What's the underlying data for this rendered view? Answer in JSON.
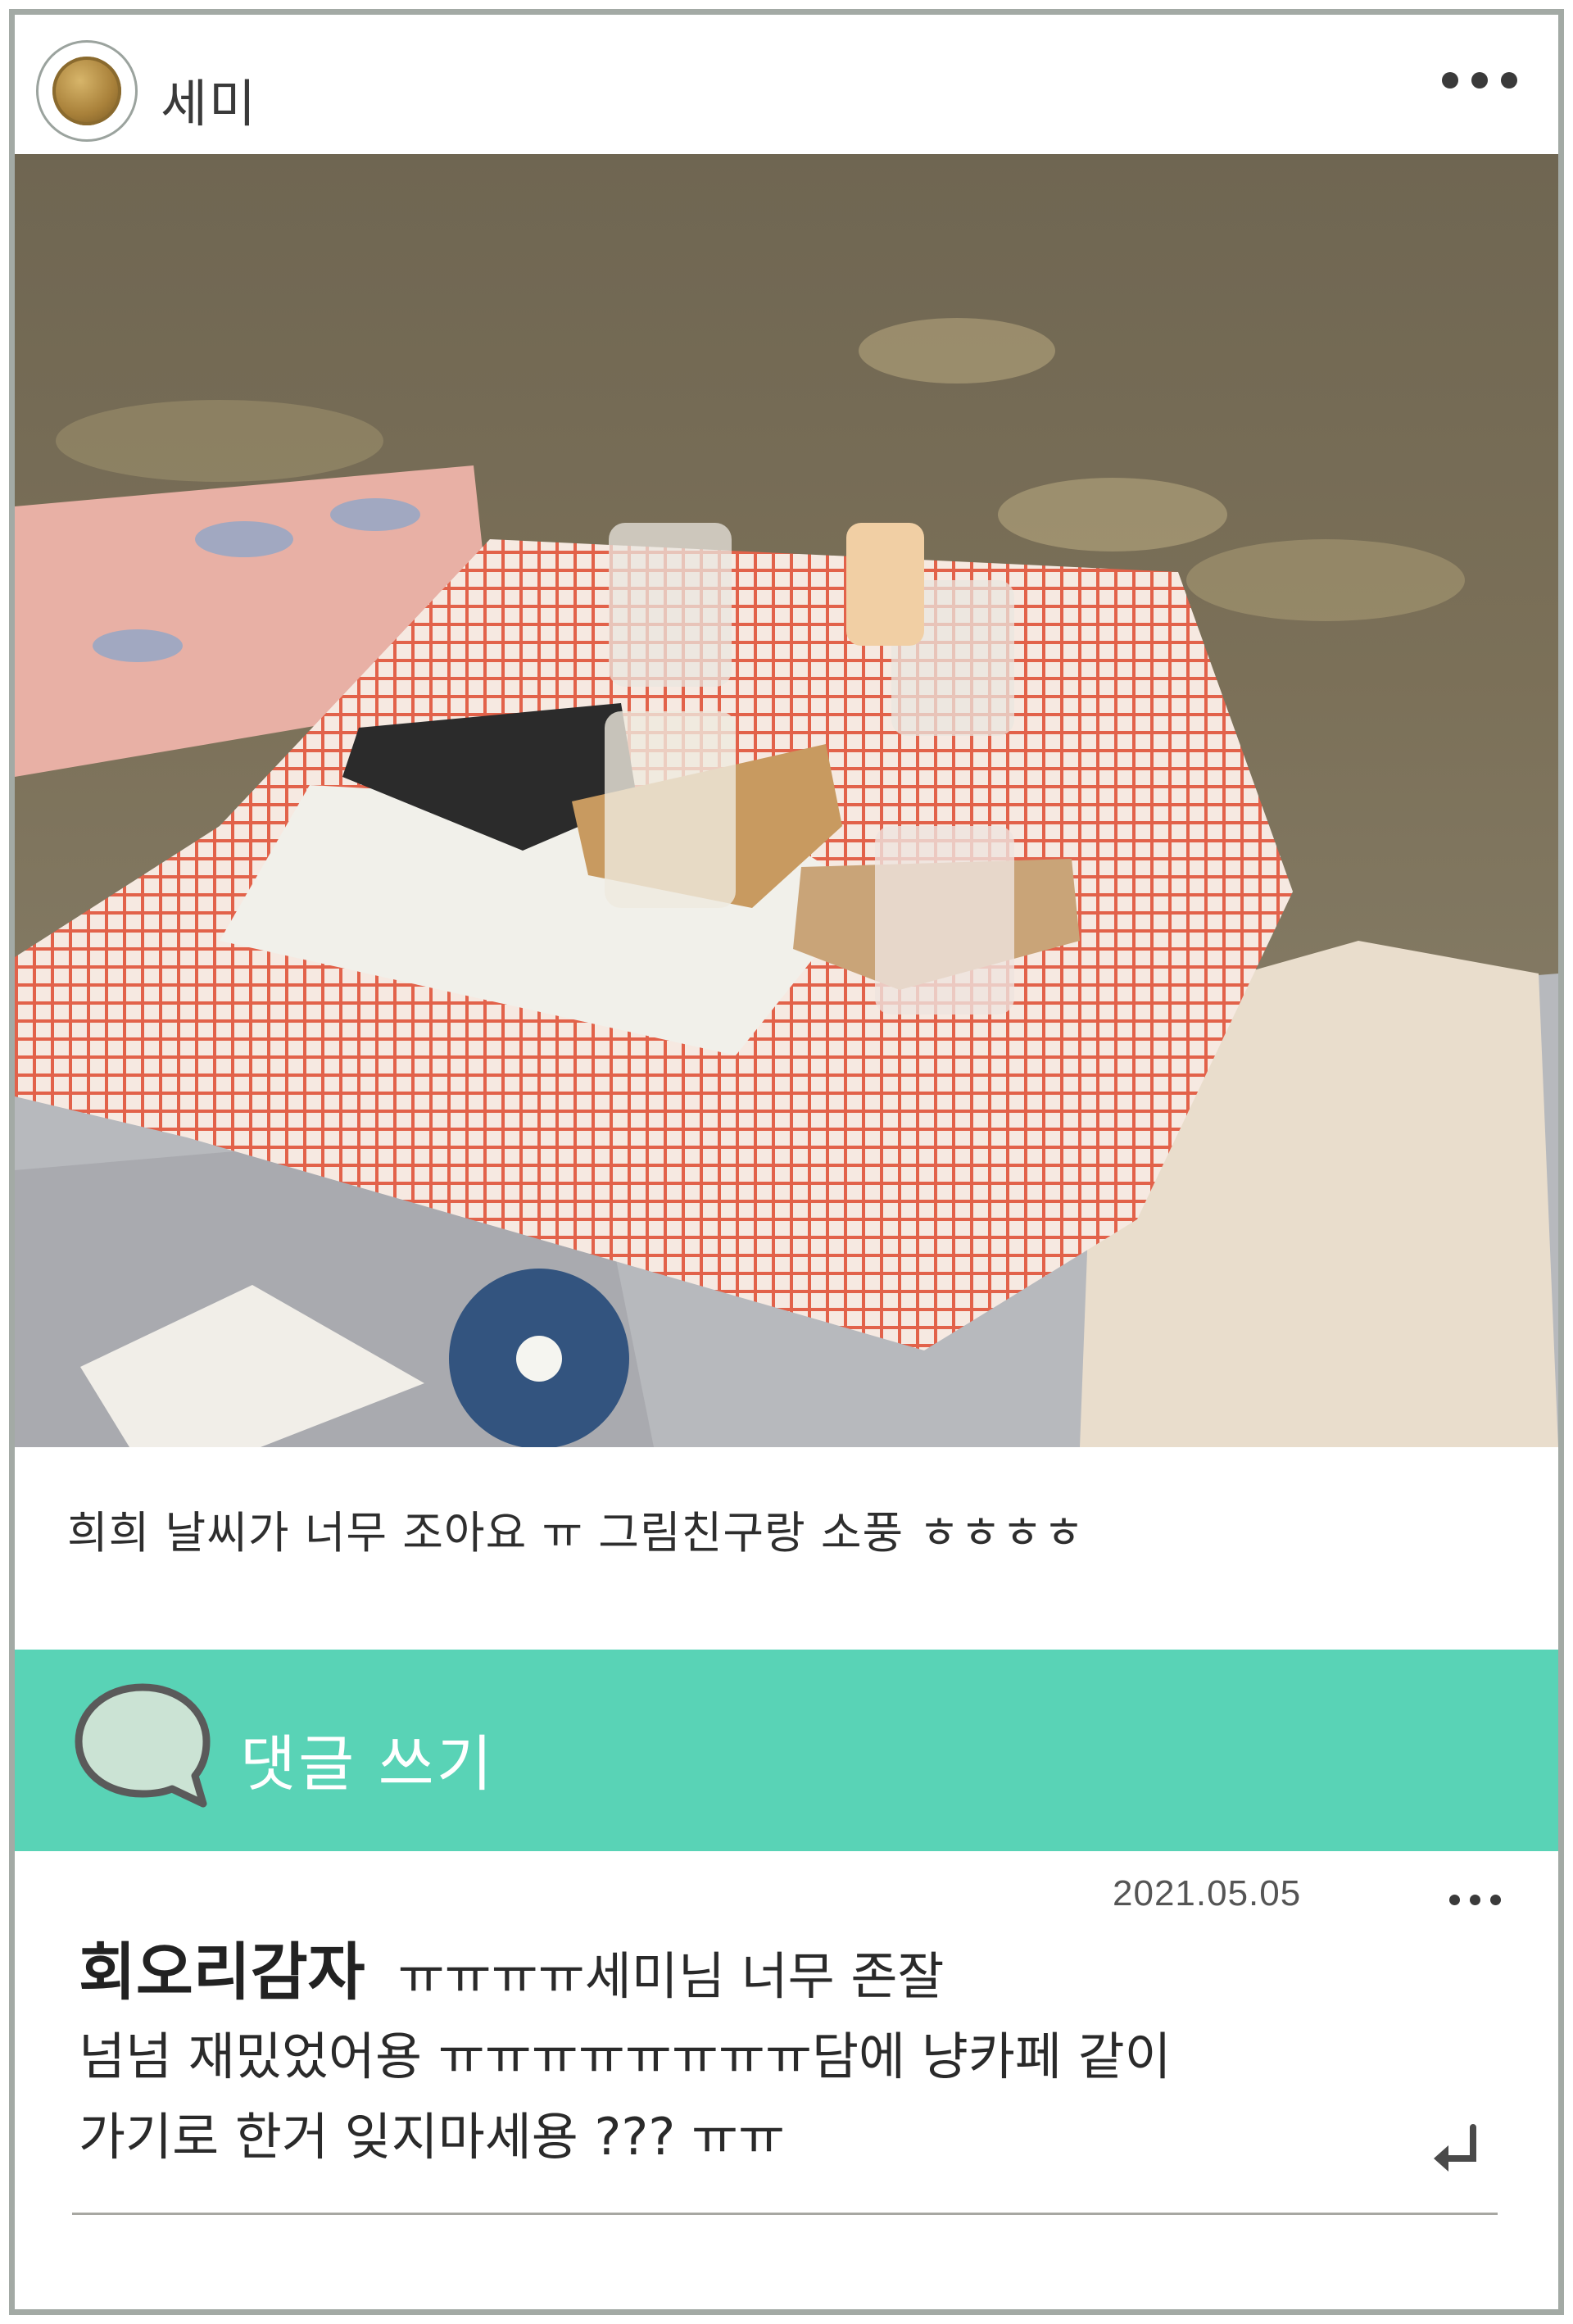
{
  "header": {
    "username": "세미",
    "avatar_icon": "coin-avatar",
    "more_icon": "more-dots-icon"
  },
  "post": {
    "caption": "희희 날씨가 너무 조아요 ㅠ  그림친구랑 소풍 ㅎㅎㅎㅎ"
  },
  "comment_bar": {
    "label": "댓글 쓰기",
    "icon": "speech-bubble-icon",
    "color": "#59d3b6"
  },
  "comment": {
    "date": "2021.05.05",
    "author": "회오리감자",
    "text_line1": "ㅠㅠㅠㅠ세미님 너무 존잘",
    "text_line2": "넘넘 재밌었어용 ㅠㅠㅠㅠㅠㅠㅠㅠ담에 냥카페 같이",
    "text_line3": "가기로 한거 잊지마세용 ??? ㅠㅠ",
    "reply_icon": "reply-arrow-icon"
  }
}
